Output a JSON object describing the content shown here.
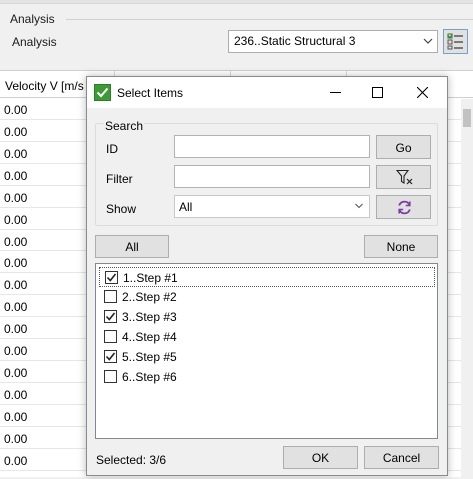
{
  "background": {
    "analysis_group_title": "Analysis",
    "analysis_label": "Analysis",
    "analysis_selected": "236..Static Structural 3",
    "grid_header": "Velocity V  [m/s",
    "grid_values": [
      "0.00",
      "0.00",
      "0.00",
      "0.00",
      "0.00",
      "0.00",
      "0.00",
      "0.00",
      "0.00",
      "0.00",
      "0.00",
      "0.00",
      "0.00",
      "0.00",
      "0.00",
      "0.00",
      "0.00"
    ]
  },
  "dialog": {
    "title": "Select Items",
    "search_title": "Search",
    "id_label": "ID",
    "id_value": "",
    "filter_label": "Filter",
    "filter_value": "",
    "show_label": "Show",
    "show_value": "All",
    "go_label": "Go",
    "all_label": "All",
    "none_label": "None",
    "items": [
      {
        "label": "1..Step #1",
        "checked": true
      },
      {
        "label": "2..Step #2",
        "checked": false
      },
      {
        "label": "3..Step #3",
        "checked": true
      },
      {
        "label": "4..Step #4",
        "checked": false
      },
      {
        "label": "5..Step #5",
        "checked": true
      },
      {
        "label": "6..Step #6",
        "checked": false
      }
    ],
    "status": "Selected: 3/6",
    "ok_label": "OK",
    "cancel_label": "Cancel"
  },
  "icons": {
    "title_icon": "green-checkbox-icon",
    "filter_button": "clear-filter-icon",
    "refresh_button": "refresh-icon",
    "analysis_button": "checklist-icon"
  },
  "colors": {
    "accent_green": "#3c9b35",
    "refresh_purple": "#7b3fa0",
    "dialog_background": "#f0f0f0"
  }
}
